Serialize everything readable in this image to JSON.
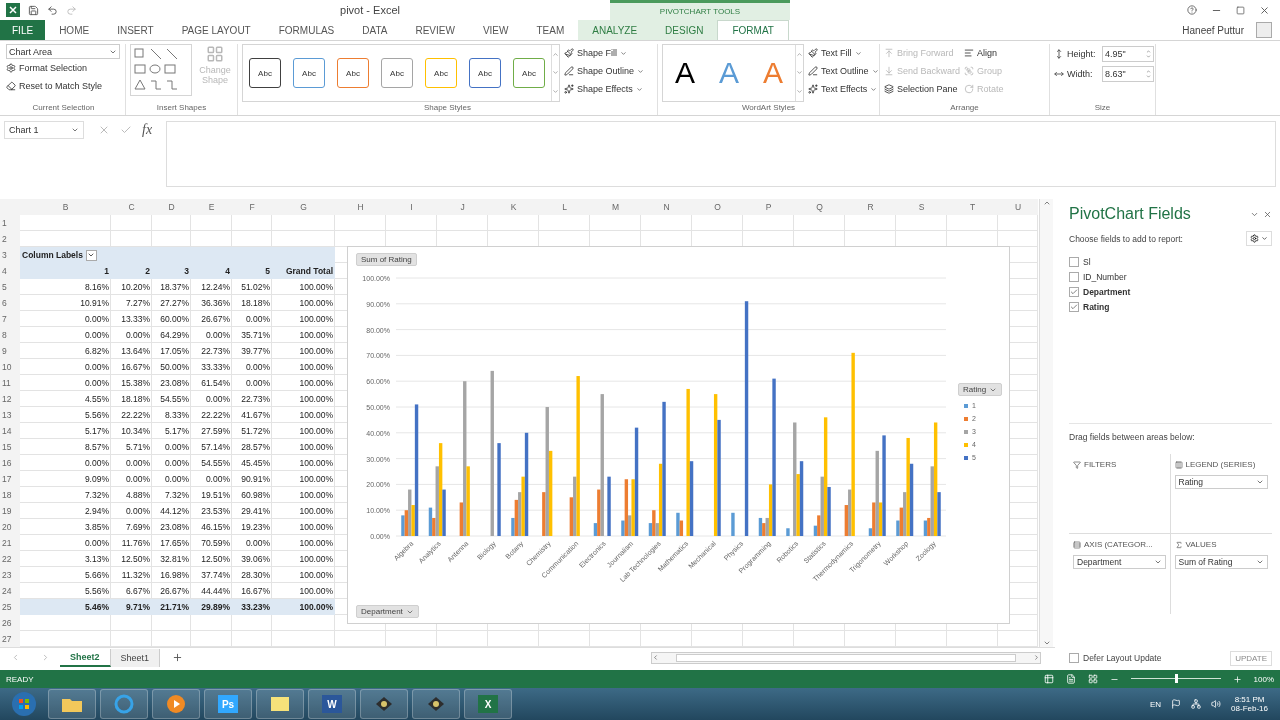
{
  "title_bar": {
    "title": "pivot - Excel",
    "context_header": "PIVOTCHART TOOLS",
    "user": "Haneef Puttur"
  },
  "ribbon_tabs": [
    {
      "label": "FILE",
      "kind": "file",
      "selected": false
    },
    {
      "label": "HOME",
      "kind": "normal",
      "selected": false
    },
    {
      "label": "INSERT",
      "kind": "normal",
      "selected": false
    },
    {
      "label": "PAGE LAYOUT",
      "kind": "normal",
      "selected": false
    },
    {
      "label": "FORMULAS",
      "kind": "normal",
      "selected": false
    },
    {
      "label": "DATA",
      "kind": "normal",
      "selected": false
    },
    {
      "label": "REVIEW",
      "kind": "normal",
      "selected": false
    },
    {
      "label": "VIEW",
      "kind": "normal",
      "selected": false
    },
    {
      "label": "TEAM",
      "kind": "normal",
      "selected": false
    },
    {
      "label": "ANALYZE",
      "kind": "context",
      "selected": false
    },
    {
      "label": "DESIGN",
      "kind": "context",
      "selected": false
    },
    {
      "label": "FORMAT",
      "kind": "context",
      "selected": true
    }
  ],
  "ribbon": {
    "current_selection": {
      "element": "Chart Area",
      "commands": [
        "Format Selection",
        "Reset to Match Style"
      ],
      "label": "Current Selection"
    },
    "insert_shapes": {
      "change_shape": "Change Shape",
      "disabled": true,
      "label": "Insert Shapes"
    },
    "shape_styles": {
      "swatches": [
        {
          "label": "Abc",
          "color": "#404040"
        },
        {
          "label": "Abc",
          "color": "#5b9bd5"
        },
        {
          "label": "Abc",
          "color": "#ed7d31"
        },
        {
          "label": "Abc",
          "color": "#a5a5a5"
        },
        {
          "label": "Abc",
          "color": "#ffc000"
        },
        {
          "label": "Abc",
          "color": "#4472c4"
        },
        {
          "label": "Abc",
          "color": "#70ad47"
        }
      ],
      "commands": [
        "Shape Fill",
        "Shape Outline",
        "Shape Effects"
      ],
      "label": "Shape Styles"
    },
    "wordart": {
      "letters": [
        {
          "label": "A",
          "color": "#000000"
        },
        {
          "label": "A",
          "color": "#5b9bd5"
        },
        {
          "label": "A",
          "color": "#ed7d31"
        }
      ],
      "commands": [
        "Text Fill",
        "Text Outline",
        "Text Effects"
      ],
      "label": "WordArt Styles"
    },
    "arrange": {
      "commands": [
        {
          "label": "Bring Forward",
          "disabled": true
        },
        {
          "label": "Send Backward",
          "disabled": true
        },
        {
          "label": "Selection Pane",
          "disabled": false
        },
        {
          "label": "Align",
          "disabled": false
        },
        {
          "label": "Group",
          "disabled": true
        },
        {
          "label": "Rotate",
          "disabled": true
        }
      ],
      "label": "Arrange"
    },
    "size": {
      "fields": [
        {
          "label": "Height:",
          "value": "4.95\""
        },
        {
          "label": "Width:",
          "value": "8.63\""
        }
      ],
      "label": "Size"
    }
  },
  "formula_bar": {
    "name_box": "Chart 1",
    "fx": "fx"
  },
  "grid": {
    "columns": [
      "B",
      "C",
      "D",
      "E",
      "F",
      "G",
      "H",
      "I",
      "J",
      "K",
      "L",
      "M",
      "N",
      "O",
      "P",
      "Q",
      "R",
      "S",
      "T",
      "U"
    ],
    "rows": [
      "1",
      "2",
      "3",
      "4",
      "5",
      "6",
      "7",
      "8",
      "9",
      "10",
      "11",
      "12",
      "13",
      "14",
      "15",
      "16",
      "17",
      "18",
      "19",
      "20",
      "21",
      "22",
      "23",
      "24",
      "25",
      "26",
      "27"
    ]
  },
  "pivot": {
    "filter_label": "Column Labels",
    "headers": [
      "1",
      "2",
      "3",
      "4",
      "5",
      "Grand Total"
    ],
    "rows": [
      [
        "8.16%",
        "10.20%",
        "18.37%",
        "12.24%",
        "51.02%",
        "100.00%"
      ],
      [
        "10.91%",
        "7.27%",
        "27.27%",
        "36.36%",
        "18.18%",
        "100.00%"
      ],
      [
        "0.00%",
        "13.33%",
        "60.00%",
        "26.67%",
        "0.00%",
        "100.00%"
      ],
      [
        "0.00%",
        "0.00%",
        "64.29%",
        "0.00%",
        "35.71%",
        "100.00%"
      ],
      [
        "6.82%",
        "13.64%",
        "17.05%",
        "22.73%",
        "39.77%",
        "100.00%"
      ],
      [
        "0.00%",
        "16.67%",
        "50.00%",
        "33.33%",
        "0.00%",
        "100.00%"
      ],
      [
        "0.00%",
        "15.38%",
        "23.08%",
        "61.54%",
        "0.00%",
        "100.00%"
      ],
      [
        "4.55%",
        "18.18%",
        "54.55%",
        "0.00%",
        "22.73%",
        "100.00%"
      ],
      [
        "5.56%",
        "22.22%",
        "8.33%",
        "22.22%",
        "41.67%",
        "100.00%"
      ],
      [
        "5.17%",
        "10.34%",
        "5.17%",
        "27.59%",
        "51.72%",
        "100.00%"
      ],
      [
        "8.57%",
        "5.71%",
        "0.00%",
        "57.14%",
        "28.57%",
        "100.00%"
      ],
      [
        "0.00%",
        "0.00%",
        "0.00%",
        "54.55%",
        "45.45%",
        "100.00%"
      ],
      [
        "9.09%",
        "0.00%",
        "0.00%",
        "0.00%",
        "90.91%",
        "100.00%"
      ],
      [
        "7.32%",
        "4.88%",
        "7.32%",
        "19.51%",
        "60.98%",
        "100.00%"
      ],
      [
        "2.94%",
        "0.00%",
        "44.12%",
        "23.53%",
        "29.41%",
        "100.00%"
      ],
      [
        "3.85%",
        "7.69%",
        "23.08%",
        "46.15%",
        "19.23%",
        "100.00%"
      ],
      [
        "0.00%",
        "11.76%",
        "17.65%",
        "70.59%",
        "0.00%",
        "100.00%"
      ],
      [
        "3.13%",
        "12.50%",
        "32.81%",
        "12.50%",
        "39.06%",
        "100.00%"
      ],
      [
        "5.66%",
        "11.32%",
        "16.98%",
        "37.74%",
        "28.30%",
        "100.00%"
      ],
      [
        "5.56%",
        "6.67%",
        "26.67%",
        "44.44%",
        "16.67%",
        "100.00%"
      ]
    ],
    "total": [
      "5.46%",
      "9.71%",
      "21.71%",
      "29.89%",
      "33.23%",
      "100.00%"
    ]
  },
  "chart": {
    "value_button": "Sum of Rating",
    "axis_button": "Department",
    "legend_button": "Rating",
    "chart_data": {
      "type": "bar",
      "categories": [
        "Algebra",
        "Analytics",
        "Antenna",
        "Biology",
        "Botany",
        "Chemistry",
        "Communication",
        "Electronics",
        "Journalism",
        "Lab Technologies",
        "Mathematics",
        "Mechanical",
        "Physics",
        "Programming",
        "Robotics",
        "Statistics",
        "Thermodynamics",
        "Trigonometry",
        "Workshop",
        "Zoology"
      ],
      "ylim": [
        0,
        100
      ],
      "grid": true,
      "legend": true,
      "yticks": [
        {
          "value": 0,
          "label": "0.00%"
        },
        {
          "value": 10,
          "label": "10.00%"
        },
        {
          "value": 20,
          "label": "20.00%"
        },
        {
          "value": 30,
          "label": "30.00%"
        },
        {
          "value": 40,
          "label": "40.00%"
        },
        {
          "value": 50,
          "label": "50.00%"
        },
        {
          "value": 60,
          "label": "60.00%"
        },
        {
          "value": 70,
          "label": "70.00%"
        },
        {
          "value": 80,
          "label": "80.00%"
        },
        {
          "value": 90,
          "label": "90.00%"
        },
        {
          "value": 100,
          "label": "100.00%"
        }
      ],
      "series": [
        {
          "name": "1",
          "color": "#5b9bd5",
          "values": [
            8,
            11,
            0,
            0,
            7,
            0,
            0,
            5,
            6,
            5,
            9,
            0,
            9,
            7,
            3,
            4,
            0,
            3,
            6,
            6
          ]
        },
        {
          "name": "2",
          "color": "#ed7d31",
          "values": [
            10,
            7,
            13,
            0,
            14,
            17,
            15,
            18,
            22,
            10,
            6,
            0,
            0,
            5,
            0,
            8,
            12,
            13,
            11,
            7
          ]
        },
        {
          "name": "3",
          "color": "#a5a5a5",
          "values": [
            18,
            27,
            60,
            64,
            17,
            50,
            23,
            55,
            8,
            5,
            0,
            0,
            0,
            7,
            44,
            23,
            18,
            33,
            17,
            27
          ]
        },
        {
          "name": "4",
          "color": "#ffc000",
          "values": [
            12,
            36,
            27,
            0,
            23,
            33,
            62,
            0,
            22,
            28,
            57,
            55,
            0,
            20,
            24,
            46,
            71,
            13,
            38,
            44
          ]
        },
        {
          "name": "5",
          "color": "#4472c4",
          "values": [
            51,
            18,
            0,
            36,
            40,
            0,
            0,
            23,
            42,
            52,
            29,
            45,
            91,
            61,
            29,
            19,
            0,
            39,
            28,
            17
          ]
        }
      ]
    }
  },
  "field_pane": {
    "title": "PivotChart Fields",
    "prompt": "Choose fields to add to report:",
    "fields": [
      {
        "label": "Sl",
        "checked": false
      },
      {
        "label": "ID_Number",
        "checked": false
      },
      {
        "label": "Department",
        "checked": true
      },
      {
        "label": "Rating",
        "checked": true
      }
    ],
    "drag_hint": "Drag fields between areas below:",
    "areas": [
      {
        "kind": "filter",
        "label": "FILTERS"
      },
      {
        "kind": "legend",
        "label": "LEGEND (SERIES)",
        "item": "Rating"
      },
      {
        "kind": "axis",
        "label": "AXIS (CATEGOR...",
        "item": "Department"
      },
      {
        "kind": "values",
        "label": "VALUES",
        "item": "Sum of Rating"
      }
    ],
    "defer": {
      "label": "Defer Layout Update",
      "checked": false
    },
    "update": {
      "label": "UPDATE",
      "disabled": true
    }
  },
  "sheet_tabs": [
    {
      "label": "Sheet2",
      "selected": true
    },
    {
      "label": "Sheet1",
      "selected": false
    }
  ],
  "status_bar": {
    "status": "READY",
    "zoom": "100%",
    "zoom_slider": {
      "level": 0.5
    }
  },
  "taskbar": {
    "apps": [
      {
        "kind": "folder"
      },
      {
        "kind": "browser"
      },
      {
        "kind": "media"
      },
      {
        "kind": "letter",
        "label": "Ps",
        "color": "#31a8ff"
      },
      {
        "kind": "notes"
      },
      {
        "kind": "letter",
        "label": "W",
        "color": "#2b579a"
      },
      {
        "kind": "app"
      },
      {
        "kind": "app"
      },
      {
        "kind": "letter",
        "label": "X",
        "color": "#217346"
      }
    ],
    "language": "EN",
    "time": "8:51 PM",
    "date": "08-Feb-16"
  }
}
